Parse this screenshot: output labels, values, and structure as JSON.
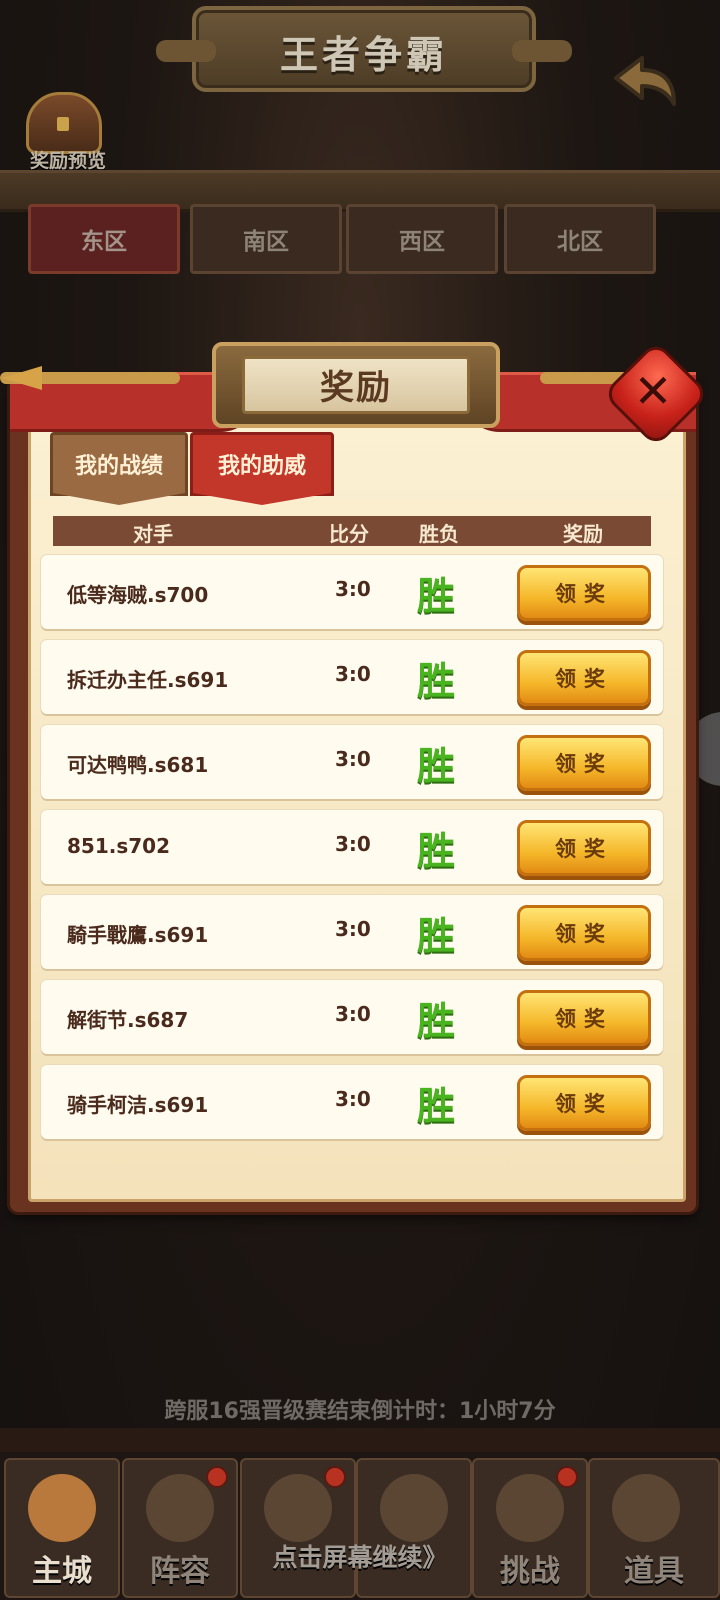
{
  "game": {
    "title": "王者争霸",
    "reward_preview_label": "奖励预览",
    "regions": [
      "东区",
      "南区",
      "西区",
      "北区"
    ],
    "countdown_text": "跨服16强晋级赛结束倒计时：1小时7分",
    "tap_to_continue": "点击屏幕继续》"
  },
  "bottom_nav": [
    {
      "label": "主城",
      "active": true,
      "badge": false
    },
    {
      "label": "阵容",
      "active": false,
      "badge": true
    },
    {
      "label": "",
      "active": false,
      "badge": true
    },
    {
      "label": "",
      "active": false,
      "badge": false
    },
    {
      "label": "挑战",
      "active": false,
      "badge": true
    },
    {
      "label": "道具",
      "active": false,
      "badge": false
    }
  ],
  "dialog": {
    "title": "奖励",
    "tabs": [
      {
        "label": "我的战绩",
        "active": false
      },
      {
        "label": "我的助威",
        "active": true
      }
    ],
    "columns": {
      "opponent": "对手",
      "score": "比分",
      "result": "胜负",
      "reward": "奖励"
    },
    "rows": [
      {
        "opponent": "低等海贼.s700",
        "score": "3:0",
        "result": "胜",
        "claim": "领奖"
      },
      {
        "opponent": "拆迁办主任.s691",
        "score": "3:0",
        "result": "胜",
        "claim": "领奖"
      },
      {
        "opponent": "可达鸭鸭.s681",
        "score": "3:0",
        "result": "胜",
        "claim": "领奖"
      },
      {
        "opponent": "851.s702",
        "score": "3:0",
        "result": "胜",
        "claim": "领奖"
      },
      {
        "opponent": "騎手戰鷹.s691",
        "score": "3:0",
        "result": "胜",
        "claim": "领奖"
      },
      {
        "opponent": "解街节.s687",
        "score": "3:0",
        "result": "胜",
        "claim": "领奖"
      },
      {
        "opponent": "骑手柯洁.s691",
        "score": "3:0",
        "result": "胜",
        "claim": "领奖"
      }
    ]
  },
  "colors": {
    "win": "#49b320",
    "accent_red": "#c3362a",
    "claim_gold": "#f5b72a"
  }
}
